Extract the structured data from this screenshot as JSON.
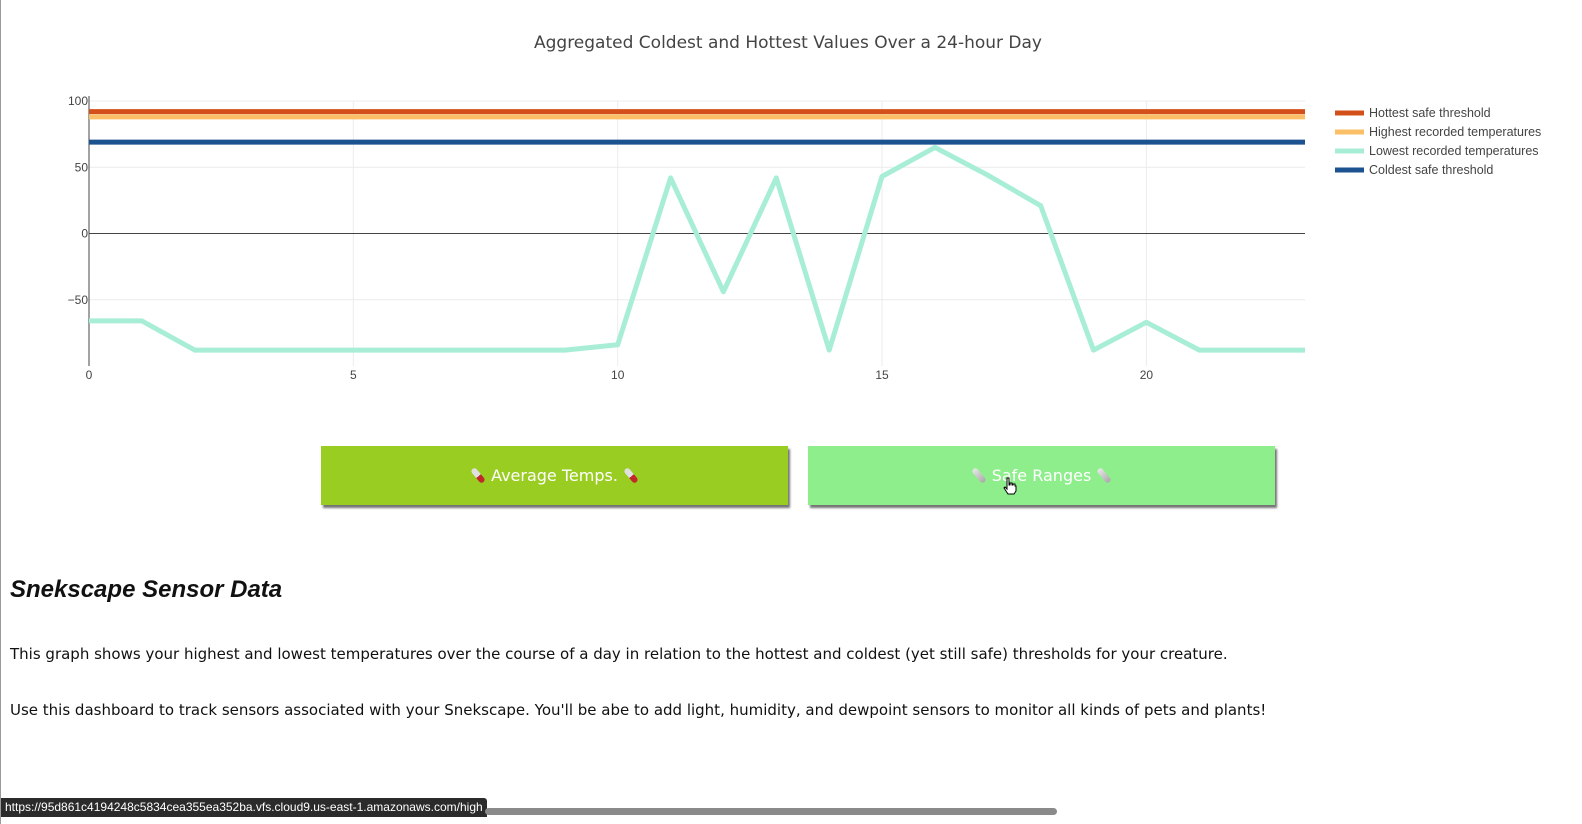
{
  "colors": {
    "hottest_threshold": "#d4501a",
    "highest_recorded": "#fbbf68",
    "lowest_recorded": "#a8eed6",
    "coldest_threshold": "#1b528f",
    "avg_button_bg": "#9acd22",
    "safe_button_bg": "#8eee8c"
  },
  "chart_data": {
    "type": "line",
    "title": "Aggregated Coldest and Hottest Values Over a 24-hour Day",
    "xlabel": "",
    "ylabel": "",
    "xlim": [
      0,
      23
    ],
    "ylim": [
      -100,
      100
    ],
    "x_ticks": [
      0,
      5,
      10,
      15,
      20
    ],
    "y_ticks": [
      100,
      50,
      0,
      -50
    ],
    "y_tick_labels": [
      "100",
      "50",
      "0",
      "−50"
    ],
    "grid": true,
    "legend_position": "right",
    "x": [
      0,
      1,
      2,
      3,
      4,
      5,
      6,
      7,
      8,
      9,
      10,
      11,
      12,
      13,
      14,
      15,
      16,
      17,
      18,
      19,
      20,
      21,
      22,
      23
    ],
    "series": [
      {
        "name": "Hottest safe threshold",
        "color": "#d4501a",
        "values": [
          92,
          92,
          92,
          92,
          92,
          92,
          92,
          92,
          92,
          92,
          92,
          92,
          92,
          92,
          92,
          92,
          92,
          92,
          92,
          92,
          92,
          92,
          92,
          92
        ]
      },
      {
        "name": "Highest recorded temperatures",
        "color": "#fbbf68",
        "values": [
          88,
          88,
          88,
          88,
          88,
          88,
          88,
          88,
          88,
          88,
          88,
          88,
          88,
          88,
          88,
          88,
          88,
          88,
          88,
          88,
          88,
          88,
          88,
          88
        ]
      },
      {
        "name": "Lowest recorded temperatures",
        "color": "#a8eed6",
        "values": [
          -66,
          -66,
          -88,
          -88,
          -88,
          -88,
          -88,
          -88,
          -88,
          -88,
          -84,
          42,
          -44,
          42,
          -88,
          43,
          65,
          44,
          21,
          -88,
          -67,
          -88,
          -88,
          -88
        ]
      },
      {
        "name": "Coldest safe threshold",
        "color": "#1b528f",
        "values": [
          69,
          69,
          69,
          69,
          69,
          69,
          69,
          69,
          69,
          69,
          69,
          69,
          69,
          69,
          69,
          69,
          69,
          69,
          69,
          69,
          69,
          69,
          69,
          69
        ]
      }
    ]
  },
  "buttons": {
    "avg_label": "Average Temps.",
    "safe_label": "Safe Ranges"
  },
  "content": {
    "heading": "Snekscape Sensor Data",
    "paragraph_1": "This graph shows your highest and lowest temperatures over the course of a day in relation to the hottest and coldest (yet still safe) thresholds for your creature.",
    "paragraph_2": "Use this dashboard to track sensors associated with your Snekscape. You'll be abe to add light, humidity, and dewpoint sensors to monitor all kinds of pets and plants!"
  },
  "status": {
    "url": "https://95d861c4194248c5834cea355ea352ba.vfs.cloud9.us-east-1.amazonaws.com/high"
  }
}
